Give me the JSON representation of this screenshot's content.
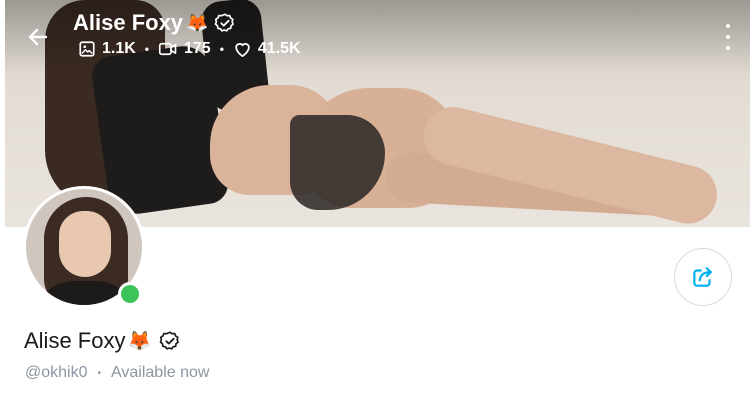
{
  "profile": {
    "name": "Alise Foxy",
    "emoji": "🦊",
    "handle": "@okhik0",
    "status": "Available now"
  },
  "stats": {
    "photos": "1.1K",
    "videos": "175",
    "likes": "41.5K"
  },
  "icons": {
    "back": "arrow-left-icon",
    "verified": "verified-badge-icon",
    "photos": "image-icon",
    "videos": "video-icon",
    "likes": "heart-icon",
    "more": "more-vertical-icon",
    "share": "share-icon"
  },
  "colors": {
    "accent": "#00aff0",
    "online": "#3cc45b",
    "muted": "#8a96a3"
  }
}
